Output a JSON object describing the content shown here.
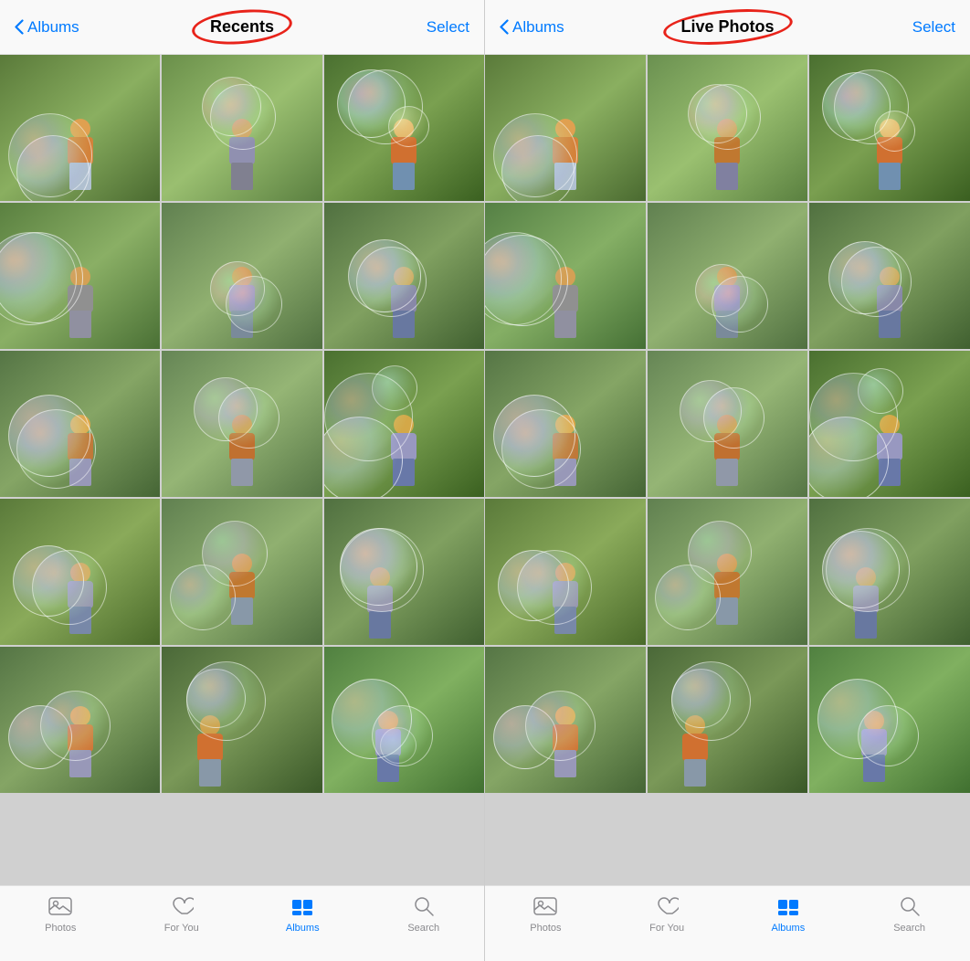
{
  "panels": [
    {
      "id": "left",
      "nav": {
        "back_label": "Albums",
        "title": "Recents",
        "select_label": "Select"
      },
      "tabs": [
        {
          "id": "photos",
          "label": "Photos",
          "icon": "photos-icon",
          "active": false
        },
        {
          "id": "for-you",
          "label": "For You",
          "icon": "for-you-icon",
          "active": false
        },
        {
          "id": "albums",
          "label": "Albums",
          "icon": "albums-icon",
          "active": true
        },
        {
          "id": "search",
          "label": "Search",
          "icon": "search-icon",
          "active": false
        }
      ]
    },
    {
      "id": "right",
      "nav": {
        "back_label": "Albums",
        "title": "Live Photos",
        "select_label": "Select"
      },
      "tabs": [
        {
          "id": "photos",
          "label": "Photos",
          "icon": "photos-icon",
          "active": false
        },
        {
          "id": "for-you",
          "label": "For You",
          "icon": "for-you-icon",
          "active": false
        },
        {
          "id": "albums",
          "label": "Albums",
          "icon": "albums-icon",
          "active": true
        },
        {
          "id": "search",
          "label": "Search",
          "icon": "search-icon",
          "active": false
        }
      ]
    }
  ],
  "photo_count": 15
}
